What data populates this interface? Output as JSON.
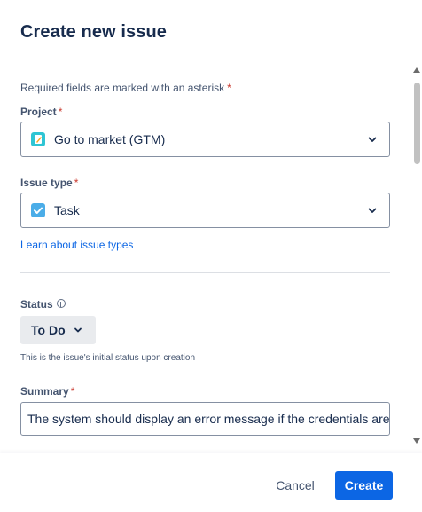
{
  "dialog": {
    "title": "Create new issue",
    "required_note": "Required fields are marked with an asterisk",
    "asterisk": "*"
  },
  "project": {
    "label": "Project",
    "value": "Go to market (GTM)"
  },
  "issue_type": {
    "label": "Issue type",
    "value": "Task",
    "help_link": "Learn about issue types"
  },
  "status": {
    "label": "Status",
    "value": "To Do",
    "helper": "This is the issue's initial status upon creation"
  },
  "summary": {
    "label": "Summary",
    "value": "The system should display an error message if the credentials are"
  },
  "footer": {
    "cancel_label": "Cancel",
    "create_label": "Create"
  },
  "colors": {
    "primary": "#0c66e4",
    "required": "#c9372c",
    "project_icon": "#2fc5d4",
    "task_icon": "#4bade8"
  }
}
